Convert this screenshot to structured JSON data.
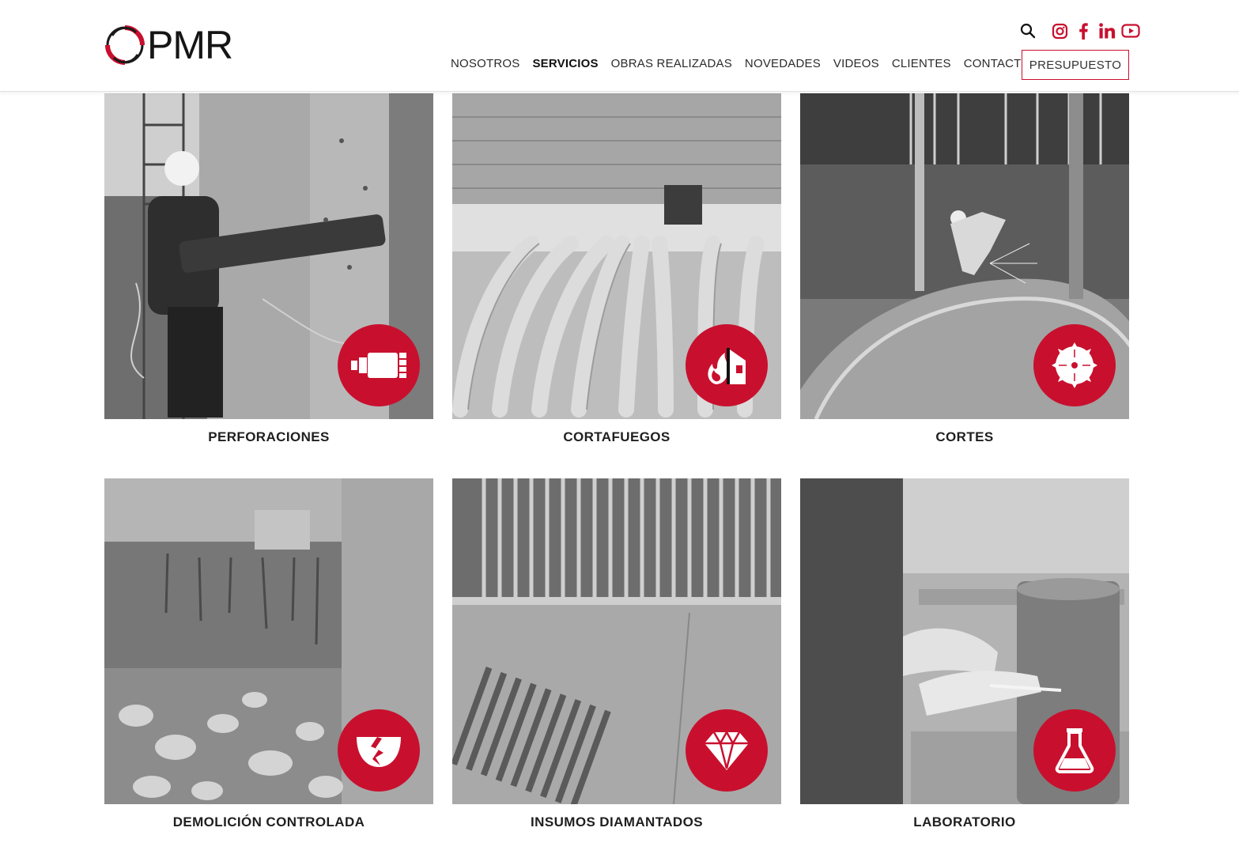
{
  "brand": {
    "logo_text": "PMR",
    "accent": "#c8102e",
    "progress": 0.2
  },
  "header": {
    "icons": [
      "search-icon",
      "instagram-icon",
      "facebook-icon",
      "linkedin-icon",
      "youtube-icon"
    ],
    "nav": [
      {
        "label": "NOSOTROS",
        "active": false
      },
      {
        "label": "SERVICIOS",
        "active": true
      },
      {
        "label": "OBRAS REALIZADAS",
        "active": false
      },
      {
        "label": "NOVEDADES",
        "active": false
      },
      {
        "label": "VIDEOS",
        "active": false
      },
      {
        "label": "CLIENTES",
        "active": false
      },
      {
        "label": "CONTACTO",
        "active": false
      }
    ],
    "cta": "PRESUPUESTO"
  },
  "services": [
    {
      "title": "PERFORACIONES",
      "icon": "core-drill-icon"
    },
    {
      "title": "CORTAFUEGOS",
      "icon": "fire-house-icon"
    },
    {
      "title": "CORTES",
      "icon": "saw-blade-icon"
    },
    {
      "title": "DEMOLICIÓN CONTROLADA",
      "icon": "cracked-bowl-icon"
    },
    {
      "title": "INSUMOS DIAMANTADOS",
      "icon": "diamond-icon"
    },
    {
      "title": "LABORATORIO",
      "icon": "flask-icon"
    }
  ]
}
